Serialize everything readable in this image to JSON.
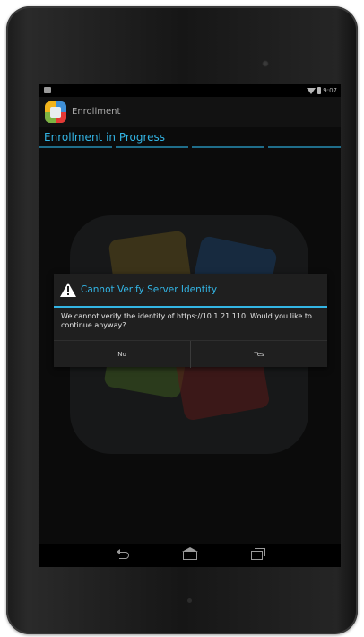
{
  "statusbar": {
    "time": "9:07",
    "icons": [
      "notification-icon",
      "wifi-icon",
      "battery-icon"
    ]
  },
  "actionbar": {
    "title": "Enrollment",
    "app_icon": "app-logo-icon"
  },
  "page": {
    "subtitle": "Enrollment in Progress"
  },
  "dialog": {
    "icon": "warning-icon",
    "title": "Cannot Verify Server Identity",
    "message": "We cannot verify the identity of https://10.1.21.110. Would you like to continue anyway?",
    "buttons": {
      "negative": "No",
      "positive": "Yes"
    }
  },
  "navbar": {
    "buttons": [
      "back-icon",
      "home-icon",
      "recents-icon"
    ]
  },
  "colors": {
    "accent": "#33b5e5",
    "dialog_bg": "#1f1f1f",
    "screen_bg": "#0b0b0b",
    "device_body": "#1a1a1a"
  }
}
